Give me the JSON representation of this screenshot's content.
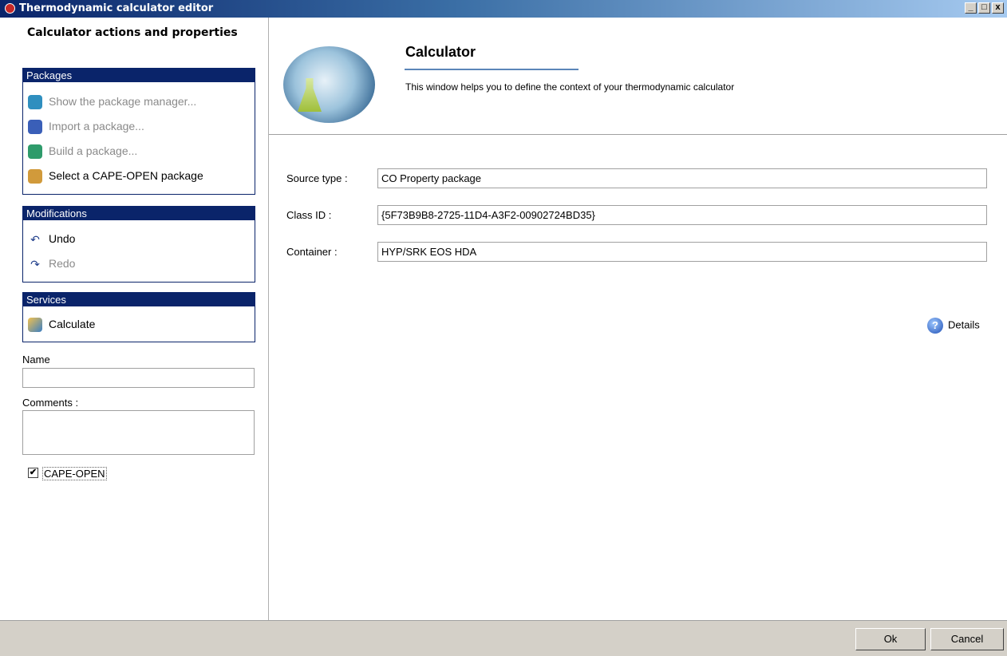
{
  "window": {
    "title": "Thermodynamic calculator editor",
    "minimize": "_",
    "maximize": "□",
    "close": "x"
  },
  "sidebar": {
    "header": "Calculator actions and properties",
    "packages": {
      "title": "Packages",
      "items": [
        {
          "label": "Show the package manager...",
          "icon": "package-manager-icon",
          "enabled": false
        },
        {
          "label": "Import a package...",
          "icon": "import-package-icon",
          "enabled": false
        },
        {
          "label": "Build a package...",
          "icon": "build-package-icon",
          "enabled": false
        },
        {
          "label": "Select a CAPE-OPEN package",
          "icon": "cape-open-package-icon",
          "enabled": true
        }
      ]
    },
    "modifications": {
      "title": "Modifications",
      "items": [
        {
          "label": "Undo",
          "icon": "undo-icon",
          "enabled": true
        },
        {
          "label": "Redo",
          "icon": "redo-icon",
          "enabled": false
        }
      ]
    },
    "services": {
      "title": "Services",
      "items": [
        {
          "label": "Calculate",
          "icon": "calculate-icon",
          "enabled": true
        }
      ]
    },
    "name_label": "Name",
    "name_value": "",
    "comments_label": "Comments :",
    "comments_value": "",
    "cape_open_label": "CAPE-OPEN",
    "cape_open_checked": true
  },
  "main": {
    "title": "Calculator",
    "description": "This window helps you to define the context of your thermodynamic calculator",
    "fields": [
      {
        "label": "Source type :",
        "value": "CO Property package"
      },
      {
        "label": "Class ID :",
        "value": "{5F73B9B8-2725-11D4-A3F2-00902724BD35}"
      },
      {
        "label": "Container :",
        "value": "HYP/SRK EOS HDA"
      }
    ],
    "details_label": "Details"
  },
  "footer": {
    "ok_label": "Ok",
    "cancel_label": "Cancel"
  }
}
